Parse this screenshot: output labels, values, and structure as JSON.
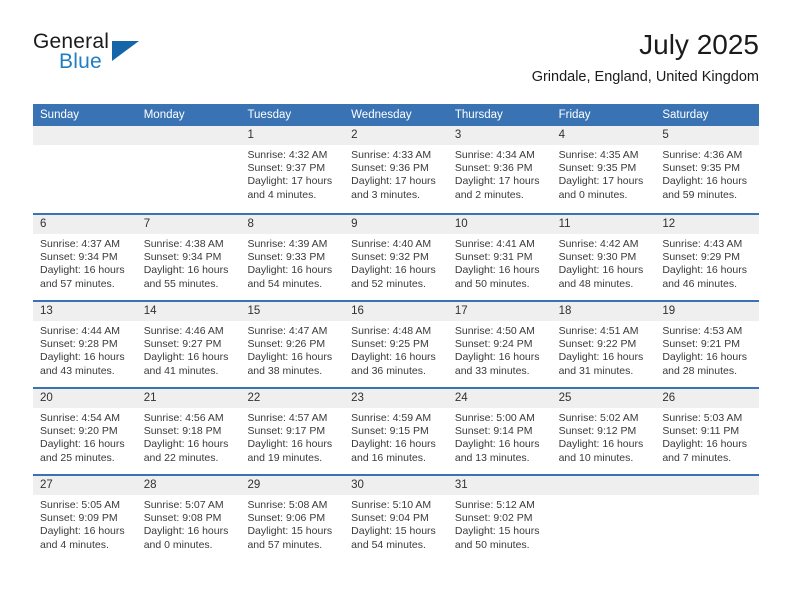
{
  "brand": {
    "name_part1": "General",
    "name_part2": "Blue",
    "logo_icon": "triangle-logo-icon",
    "accent_color": "#1f7ec4",
    "triangle_color": "#1565a8"
  },
  "header": {
    "title": "July 2025",
    "subtitle": "Grindale, England, United Kingdom"
  },
  "theme": {
    "header_blue": "#3a73b4",
    "day_band_gray": "#efeff0",
    "text_color": "#3a3a3a"
  },
  "calendar": {
    "weekday_headers": [
      "Sunday",
      "Monday",
      "Tuesday",
      "Wednesday",
      "Thursday",
      "Friday",
      "Saturday"
    ],
    "weeks": [
      [
        {
          "day": "",
          "lines": []
        },
        {
          "day": "",
          "lines": []
        },
        {
          "day": "1",
          "lines": [
            "Sunrise: 4:32 AM",
            "Sunset: 9:37 PM",
            "Daylight: 17 hours",
            "and 4 minutes."
          ]
        },
        {
          "day": "2",
          "lines": [
            "Sunrise: 4:33 AM",
            "Sunset: 9:36 PM",
            "Daylight: 17 hours",
            "and 3 minutes."
          ]
        },
        {
          "day": "3",
          "lines": [
            "Sunrise: 4:34 AM",
            "Sunset: 9:36 PM",
            "Daylight: 17 hours",
            "and 2 minutes."
          ]
        },
        {
          "day": "4",
          "lines": [
            "Sunrise: 4:35 AM",
            "Sunset: 9:35 PM",
            "Daylight: 17 hours",
            "and 0 minutes."
          ]
        },
        {
          "day": "5",
          "lines": [
            "Sunrise: 4:36 AM",
            "Sunset: 9:35 PM",
            "Daylight: 16 hours",
            "and 59 minutes."
          ]
        }
      ],
      [
        {
          "day": "6",
          "lines": [
            "Sunrise: 4:37 AM",
            "Sunset: 9:34 PM",
            "Daylight: 16 hours",
            "and 57 minutes."
          ]
        },
        {
          "day": "7",
          "lines": [
            "Sunrise: 4:38 AM",
            "Sunset: 9:34 PM",
            "Daylight: 16 hours",
            "and 55 minutes."
          ]
        },
        {
          "day": "8",
          "lines": [
            "Sunrise: 4:39 AM",
            "Sunset: 9:33 PM",
            "Daylight: 16 hours",
            "and 54 minutes."
          ]
        },
        {
          "day": "9",
          "lines": [
            "Sunrise: 4:40 AM",
            "Sunset: 9:32 PM",
            "Daylight: 16 hours",
            "and 52 minutes."
          ]
        },
        {
          "day": "10",
          "lines": [
            "Sunrise: 4:41 AM",
            "Sunset: 9:31 PM",
            "Daylight: 16 hours",
            "and 50 minutes."
          ]
        },
        {
          "day": "11",
          "lines": [
            "Sunrise: 4:42 AM",
            "Sunset: 9:30 PM",
            "Daylight: 16 hours",
            "and 48 minutes."
          ]
        },
        {
          "day": "12",
          "lines": [
            "Sunrise: 4:43 AM",
            "Sunset: 9:29 PM",
            "Daylight: 16 hours",
            "and 46 minutes."
          ]
        }
      ],
      [
        {
          "day": "13",
          "lines": [
            "Sunrise: 4:44 AM",
            "Sunset: 9:28 PM",
            "Daylight: 16 hours",
            "and 43 minutes."
          ]
        },
        {
          "day": "14",
          "lines": [
            "Sunrise: 4:46 AM",
            "Sunset: 9:27 PM",
            "Daylight: 16 hours",
            "and 41 minutes."
          ]
        },
        {
          "day": "15",
          "lines": [
            "Sunrise: 4:47 AM",
            "Sunset: 9:26 PM",
            "Daylight: 16 hours",
            "and 38 minutes."
          ]
        },
        {
          "day": "16",
          "lines": [
            "Sunrise: 4:48 AM",
            "Sunset: 9:25 PM",
            "Daylight: 16 hours",
            "and 36 minutes."
          ]
        },
        {
          "day": "17",
          "lines": [
            "Sunrise: 4:50 AM",
            "Sunset: 9:24 PM",
            "Daylight: 16 hours",
            "and 33 minutes."
          ]
        },
        {
          "day": "18",
          "lines": [
            "Sunrise: 4:51 AM",
            "Sunset: 9:22 PM",
            "Daylight: 16 hours",
            "and 31 minutes."
          ]
        },
        {
          "day": "19",
          "lines": [
            "Sunrise: 4:53 AM",
            "Sunset: 9:21 PM",
            "Daylight: 16 hours",
            "and 28 minutes."
          ]
        }
      ],
      [
        {
          "day": "20",
          "lines": [
            "Sunrise: 4:54 AM",
            "Sunset: 9:20 PM",
            "Daylight: 16 hours",
            "and 25 minutes."
          ]
        },
        {
          "day": "21",
          "lines": [
            "Sunrise: 4:56 AM",
            "Sunset: 9:18 PM",
            "Daylight: 16 hours",
            "and 22 minutes."
          ]
        },
        {
          "day": "22",
          "lines": [
            "Sunrise: 4:57 AM",
            "Sunset: 9:17 PM",
            "Daylight: 16 hours",
            "and 19 minutes."
          ]
        },
        {
          "day": "23",
          "lines": [
            "Sunrise: 4:59 AM",
            "Sunset: 9:15 PM",
            "Daylight: 16 hours",
            "and 16 minutes."
          ]
        },
        {
          "day": "24",
          "lines": [
            "Sunrise: 5:00 AM",
            "Sunset: 9:14 PM",
            "Daylight: 16 hours",
            "and 13 minutes."
          ]
        },
        {
          "day": "25",
          "lines": [
            "Sunrise: 5:02 AM",
            "Sunset: 9:12 PM",
            "Daylight: 16 hours",
            "and 10 minutes."
          ]
        },
        {
          "day": "26",
          "lines": [
            "Sunrise: 5:03 AM",
            "Sunset: 9:11 PM",
            "Daylight: 16 hours",
            "and 7 minutes."
          ]
        }
      ],
      [
        {
          "day": "27",
          "lines": [
            "Sunrise: 5:05 AM",
            "Sunset: 9:09 PM",
            "Daylight: 16 hours",
            "and 4 minutes."
          ]
        },
        {
          "day": "28",
          "lines": [
            "Sunrise: 5:07 AM",
            "Sunset: 9:08 PM",
            "Daylight: 16 hours",
            "and 0 minutes."
          ]
        },
        {
          "day": "29",
          "lines": [
            "Sunrise: 5:08 AM",
            "Sunset: 9:06 PM",
            "Daylight: 15 hours",
            "and 57 minutes."
          ]
        },
        {
          "day": "30",
          "lines": [
            "Sunrise: 5:10 AM",
            "Sunset: 9:04 PM",
            "Daylight: 15 hours",
            "and 54 minutes."
          ]
        },
        {
          "day": "31",
          "lines": [
            "Sunrise: 5:12 AM",
            "Sunset: 9:02 PM",
            "Daylight: 15 hours",
            "and 50 minutes."
          ]
        },
        {
          "day": "",
          "lines": []
        },
        {
          "day": "",
          "lines": []
        }
      ]
    ]
  }
}
